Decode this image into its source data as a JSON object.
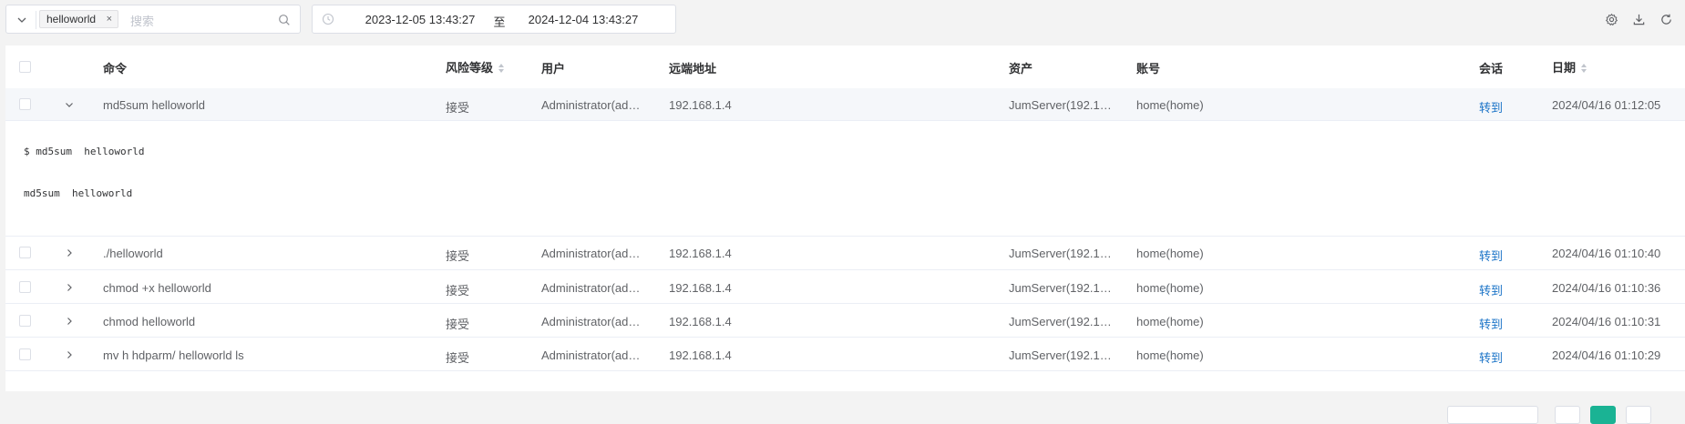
{
  "filter": {
    "tag": "helloworld",
    "tag_close": "×",
    "search_placeholder": "搜索",
    "date_start": "2023-12-05 13:43:27",
    "date_sep": "至",
    "date_end": "2024-12-04 13:43:27"
  },
  "toolbar_icons": [
    "gear-icon",
    "download-icon",
    "refresh-icon"
  ],
  "table": {
    "headers": {
      "command": "命令",
      "risk": "风险等级",
      "user": "用户",
      "remote": "远端地址",
      "asset": "资产",
      "account": "账号",
      "session": "会话",
      "date": "日期"
    },
    "rows": [
      {
        "command": "md5sum helloworld",
        "risk": "接受",
        "user": "Administrator(ad…",
        "remote": "192.168.1.4",
        "asset": "JumServer(192.1…",
        "account": "home(home)",
        "session": "转到",
        "date": "2024/04/16 01:12:05"
      },
      {
        "command": "./helloworld",
        "risk": "接受",
        "user": "Administrator(ad…",
        "remote": "192.168.1.4",
        "asset": "JumServer(192.1…",
        "account": "home(home)",
        "session": "转到",
        "date": "2024/04/16 01:10:40"
      },
      {
        "command": "chmod +x helloworld",
        "risk": "接受",
        "user": "Administrator(ad…",
        "remote": "192.168.1.4",
        "asset": "JumServer(192.1…",
        "account": "home(home)",
        "session": "转到",
        "date": "2024/04/16 01:10:36"
      },
      {
        "command": "chmod helloworld",
        "risk": "接受",
        "user": "Administrator(ad…",
        "remote": "192.168.1.4",
        "asset": "JumServer(192.1…",
        "account": "home(home)",
        "session": "转到",
        "date": "2024/04/16 01:10:31"
      },
      {
        "command": "mv h hdparm/ helloworld ls",
        "risk": "接受",
        "user": "Administrator(ad…",
        "remote": "192.168.1.4",
        "asset": "JumServer(192.1…",
        "account": "home(home)",
        "session": "转到",
        "date": "2024/04/16 01:10:29"
      }
    ],
    "expanded_detail": {
      "input_line": "$ md5sum  helloworld",
      "output_line": "md5sum  helloworld"
    }
  },
  "colors": {
    "link": "#1a73c7",
    "accent": "#1ab394",
    "header_text": "#303133"
  }
}
